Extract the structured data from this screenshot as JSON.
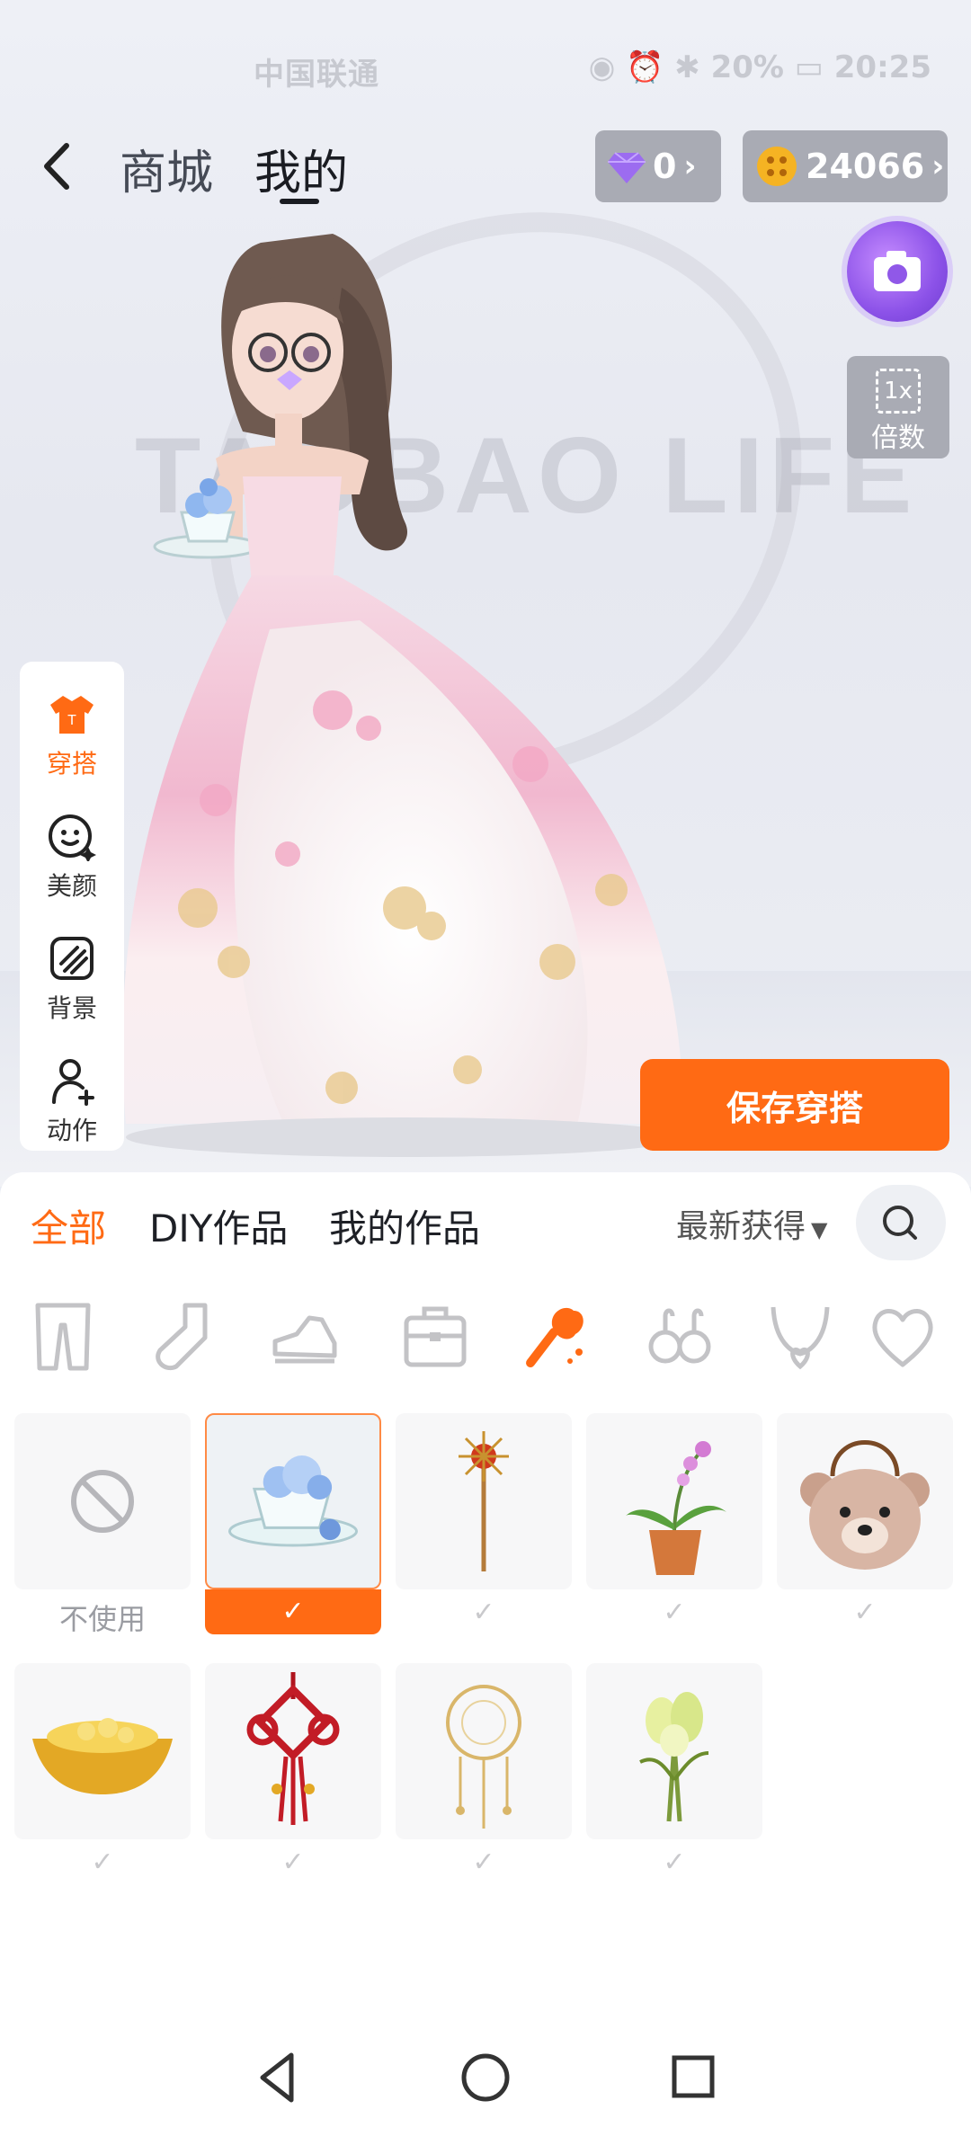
{
  "status_bar": {
    "carrier": "中国联通",
    "right": "◉ ⏰ ✱ 20% ▭ 20:25"
  },
  "header": {
    "tabs": [
      {
        "label": "商城",
        "active": false
      },
      {
        "label": "我的",
        "active": true
      }
    ],
    "gems": "0",
    "coins": "24066"
  },
  "scene": {
    "watermark": "TAOBAO LIFE",
    "zoom_label": "倍数",
    "zoom_icon_text": "1x"
  },
  "side_panel": {
    "items": [
      {
        "label": "穿搭",
        "icon": "outfit-icon",
        "active": true
      },
      {
        "label": "美颜",
        "icon": "face-icon",
        "active": false
      },
      {
        "label": "背景",
        "icon": "background-icon",
        "active": false
      },
      {
        "label": "动作",
        "icon": "action-icon",
        "active": false
      }
    ]
  },
  "save_button": "保存穿搭",
  "filters": {
    "tabs": [
      "全部",
      "DIY作品",
      "我的作品"
    ],
    "sort": "最新获得"
  },
  "categories": [
    "pants-icon",
    "sock-icon",
    "shoe-icon",
    "bag-icon",
    "handheld-icon",
    "earring-icon",
    "necklace-icon",
    "heart-icon"
  ],
  "items": {
    "no_use_label": "不使用",
    "list": [
      {
        "name": "no-use",
        "selected": false
      },
      {
        "name": "teacup-with-flowers",
        "selected": true
      },
      {
        "name": "sun-scepter",
        "selected": false
      },
      {
        "name": "potted-orchid",
        "selected": false
      },
      {
        "name": "bear-bag",
        "selected": false
      },
      {
        "name": "gold-ingot",
        "selected": false
      },
      {
        "name": "red-chinese-knot",
        "selected": false
      },
      {
        "name": "dreamcatcher",
        "selected": false
      },
      {
        "name": "flower-bouquet",
        "selected": false
      }
    ]
  },
  "colors": {
    "accent": "#ff6a14",
    "gem": "#9c6cf0",
    "coin": "#f5b323"
  }
}
